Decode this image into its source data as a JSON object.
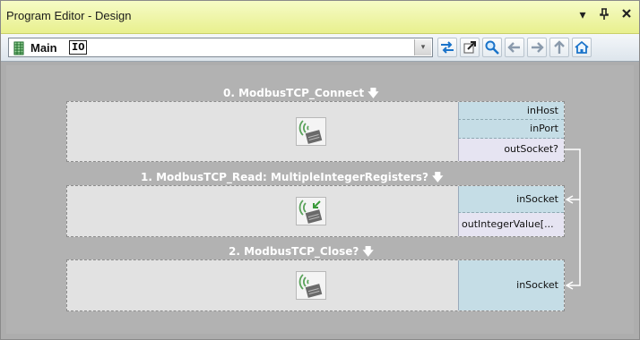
{
  "window": {
    "title": "Program Editor - Design",
    "controls": {
      "dropdown": "▾",
      "pin": "ꟸ",
      "close": "×"
    }
  },
  "toolbar": {
    "path_main": "Main",
    "path_io": "IO",
    "combo_arrow": "▾",
    "buttons": [
      "swap-icon",
      "open-external-icon",
      "search-icon",
      "back-arrow-icon",
      "forward-arrow-icon",
      "up-arrow-icon",
      "home-icon"
    ]
  },
  "blocks": [
    {
      "title": "0. ModbusTCP_Connect",
      "title_marker": "🡇",
      "ports": [
        {
          "label": "inHost",
          "kind": "in"
        },
        {
          "label": "inPort",
          "kind": "in"
        },
        {
          "label": "outSocket?",
          "kind": "out"
        }
      ]
    },
    {
      "title": "1. ModbusTCP_Read: MultipleIntegerRegisters?",
      "title_marker": "🡇",
      "ports": [
        {
          "label": "inSocket",
          "kind": "in"
        },
        {
          "label": "outIntegerValue[...",
          "kind": "out"
        }
      ]
    },
    {
      "title": "2. ModbusTCP_Close?",
      "title_marker": "🡇",
      "ports": [
        {
          "label": "inSocket",
          "kind": "in"
        }
      ]
    }
  ],
  "colors": {
    "titlebar": "#e8f08e",
    "canvas": "#b2b2b2",
    "block": "#e2e2e2",
    "port_in": "#c5dde6",
    "port_out": "#e6e4f2",
    "connector": "#ffffff"
  }
}
